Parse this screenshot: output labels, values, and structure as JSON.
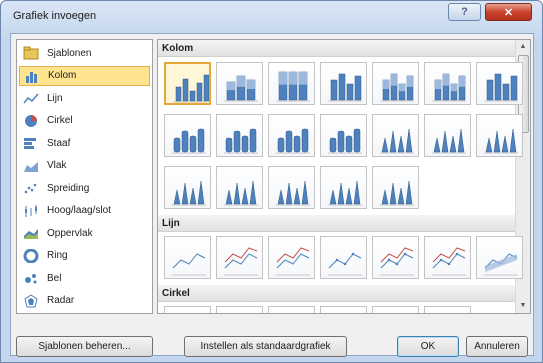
{
  "window": {
    "title": "Grafiek invoegen",
    "help_glyph": "?",
    "close_glyph": "✕"
  },
  "categories": [
    {
      "label": "Sjablonen",
      "icon": "folder-icon"
    },
    {
      "label": "Kolom",
      "icon": "column-chart-icon",
      "selected": true
    },
    {
      "label": "Lijn",
      "icon": "line-chart-icon"
    },
    {
      "label": "Cirkel",
      "icon": "pie-chart-icon"
    },
    {
      "label": "Staaf",
      "icon": "bar-chart-icon"
    },
    {
      "label": "Vlak",
      "icon": "area-chart-icon"
    },
    {
      "label": "Spreiding",
      "icon": "scatter-chart-icon"
    },
    {
      "label": "Hoog/laag/slot",
      "icon": "stock-chart-icon"
    },
    {
      "label": "Oppervlak",
      "icon": "surface-chart-icon"
    },
    {
      "label": "Ring",
      "icon": "doughnut-chart-icon"
    },
    {
      "label": "Bel",
      "icon": "bubble-chart-icon"
    },
    {
      "label": "Radar",
      "icon": "radar-chart-icon"
    }
  ],
  "gallery": {
    "sections": [
      {
        "title": "Kolom"
      },
      {
        "title": "Lijn"
      },
      {
        "title": "Cirkel"
      }
    ],
    "column_thumbnails": [
      "clustered-column",
      "stacked-column",
      "100-stacked-column",
      "3d-clustered-column",
      "3d-stacked-column",
      "3d-100-stacked-column",
      "3d-column",
      "clustered-cylinder",
      "stacked-cylinder",
      "100-stacked-cylinder",
      "3d-cylinder",
      "clustered-cone",
      "stacked-cone",
      "100-stacked-cone",
      "3d-cone",
      "clustered-pyramid",
      "stacked-pyramid",
      "100-stacked-pyramid",
      "3d-pyramid"
    ],
    "line_thumbnails": [
      "line",
      "stacked-line",
      "100-stacked-line",
      "line-with-markers",
      "stacked-line-with-markers",
      "100-stacked-line-with-markers",
      "3d-line"
    ],
    "pie_thumbnails": [
      "pie",
      "3d-pie",
      "pie-of-pie",
      "exploded-pie",
      "3d-exploded-pie",
      "bar-of-pie"
    ]
  },
  "buttons": {
    "manage_templates": "Sjablonen beheren...",
    "set_default": "Instellen als standaardgrafiek",
    "ok": "OK",
    "cancel": "Annuleren"
  },
  "colors": {
    "selection": "#ffe38f",
    "chart_blue": "#4f81bd"
  }
}
